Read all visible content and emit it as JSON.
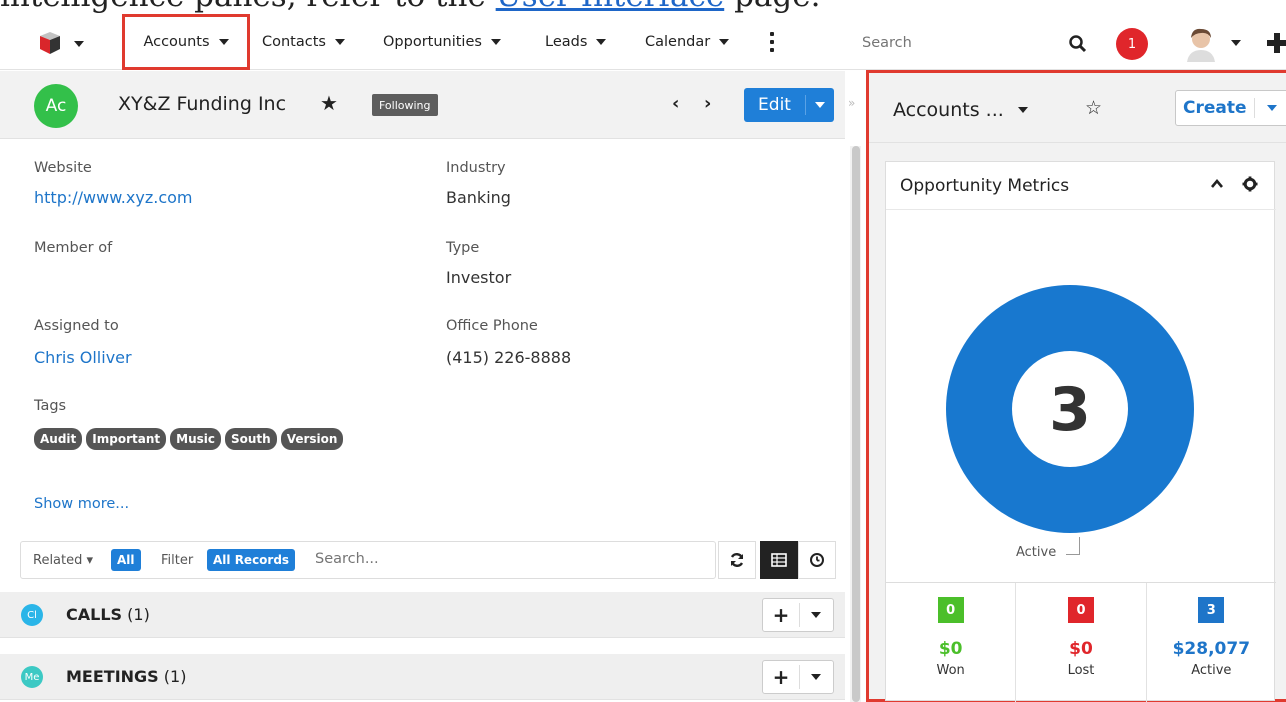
{
  "doc_text": {
    "prefix": "intelligence panes, refer to the ",
    "link": "User Interface",
    "suffix": " page."
  },
  "nav": {
    "items": [
      {
        "label": "Accounts"
      },
      {
        "label": "Contacts"
      },
      {
        "label": "Opportunities"
      },
      {
        "label": "Leads"
      },
      {
        "label": "Calendar"
      }
    ],
    "search_placeholder": "Search",
    "notifications_count": "1"
  },
  "record": {
    "avatar": "Ac",
    "name": "XY&Z Funding Inc",
    "following": "Following",
    "edit_label": "Edit",
    "fields": {
      "website_label": "Website",
      "website_value": "http://www.xyz.com",
      "industry_label": "Industry",
      "industry_value": "Banking",
      "member_label": "Member of",
      "type_label": "Type",
      "type_value": "Investor",
      "assigned_label": "Assigned to",
      "assigned_value": "Chris Olliver",
      "phone_label": "Office Phone",
      "phone_value": "(415) 226-8888",
      "tags_label": "Tags"
    },
    "tags": [
      "Audit",
      "Important",
      "Music",
      "South",
      "Version"
    ],
    "show_more": "Show more..."
  },
  "related": {
    "related_label": "Related",
    "related_value": "All",
    "filter_label": "Filter",
    "filter_value": "All Records",
    "search_placeholder": "Search..."
  },
  "subpanels": [
    {
      "icon": "Cl",
      "title": "CALLS",
      "count": "(1)",
      "color": "#2ab5e8"
    },
    {
      "icon": "Me",
      "title": "MEETINGS",
      "count": "(1)",
      "color": "#3cc9c4"
    }
  ],
  "dashboard": {
    "title": "Accounts ...",
    "create_label": "Create",
    "dashlet_title": "Opportunity Metrics",
    "donut_value": "3",
    "donut_label": "Active",
    "donut_color": "#1878cf",
    "metrics": [
      {
        "count": "0",
        "amount": "$0",
        "label": "Won",
        "color": "#4bbf2a"
      },
      {
        "count": "0",
        "amount": "$0",
        "label": "Lost",
        "color": "#e0262b"
      },
      {
        "count": "3",
        "amount": "$28,077",
        "label": "Active",
        "color": "#1e75c9"
      }
    ]
  }
}
